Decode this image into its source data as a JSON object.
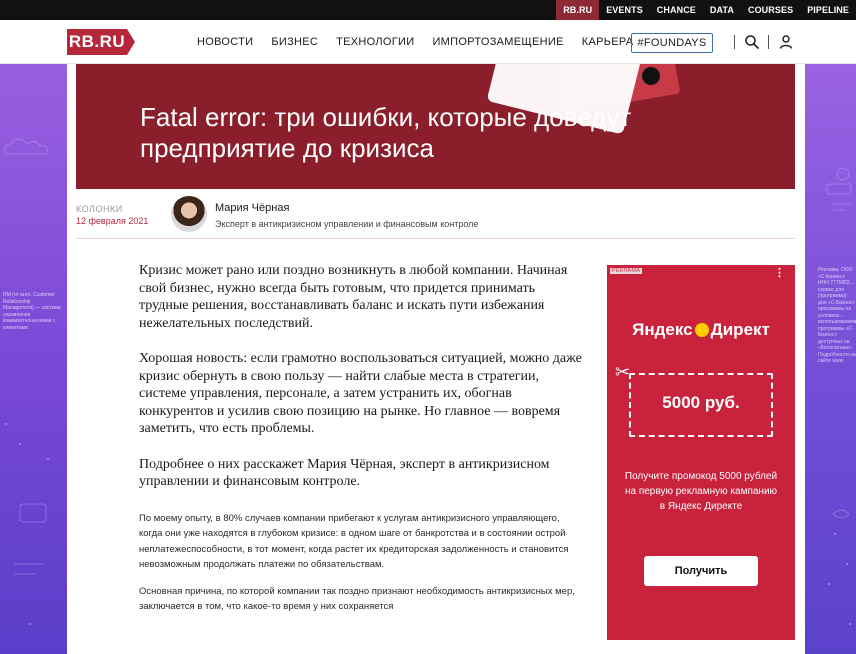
{
  "topbar": {
    "links": [
      "RB.RU",
      "EVENTS",
      "CHANCE",
      "DATA",
      "COURSES",
      "PIPELINE"
    ]
  },
  "header": {
    "logo": "RB.RU",
    "nav": [
      "НОВОСТИ",
      "БИЗНЕС",
      "ТЕХНОЛОГИИ",
      "ИМПОРТОЗАМЕЩЕНИЕ",
      "КАРЬЕРА"
    ],
    "foundays": "#FOUNDAYS",
    "icons": [
      "search-icon",
      "user-icon"
    ]
  },
  "hero": {
    "title": "Fatal error: три ошибки, которые доведут предприятие до кризиса"
  },
  "meta": {
    "rubric": "КОЛОНКИ",
    "date": "12 февраля 2021",
    "author_name": "Мария Чёрная",
    "author_role": "Эксперт в антикризисном управлении и финансовым контроле"
  },
  "article": {
    "lead": [
      "Кризис может рано или поздно возникнуть в любой компании. Начиная свой бизнес, нужно всегда быть готовым, что придется принимать трудные решения, восстанавливать баланс и искать пути избежания нежелательных последствий.",
      "Хорошая новость: если грамотно воспользоваться ситуацией, можно даже кризис обернуть в свою пользу — найти слабые места в стратегии, системе управления, персонале, а затем устранить их, обогнав конкурентов и усилив свою позицию на рынке. Но главное — вовремя заметить, что есть проблемы.",
      "Подробнее о них расскажет Мария Чёрная, эксперт в антикризисном управлении и финансовым контроле."
    ],
    "body": [
      "По моему опыту, в 80% случаев компании прибегают к услугам антикризисного управляющего, когда они уже находятся в глубоком кризисе: в одном шаге от банкротства и в состоянии острой неплатежеспособности, в тот момент, когда растет их кредиторская задолженность и становится невозможным продолжать платежи по обязательствам.",
      "Основная причина, по которой компании так поздно признают необходимость антикризисных мер, заключается в том, что какое-то время у них сохраняется"
    ]
  },
  "ad": {
    "badge": "РЕКЛАМА",
    "brand_left": "Яндекс",
    "brand_right": "Директ",
    "coupon": "5000 руб.",
    "description": "Получите промокод 5000 рублей на первую рекламную кампанию в Яндекс Директе",
    "button": "Получить"
  },
  "side": {
    "left_text": "RM (от англ. Customer Relationship Management) — система управления взаимоотношениями с клиентами",
    "right_text": "Реклама. ООО «С-Бизнес» ИНН 7775802... сервис для (программа) для «С-Бизнес» программы на условиях... использованием программы «С-Бизнес» доступных на «Бесплатные» Подробности на сайте www"
  },
  "colors": {
    "brand_red": "#b5283c",
    "hero_bg": "#8a1f2b",
    "ad_bg": "#c9223c",
    "side_purple": "#7a49d6"
  }
}
